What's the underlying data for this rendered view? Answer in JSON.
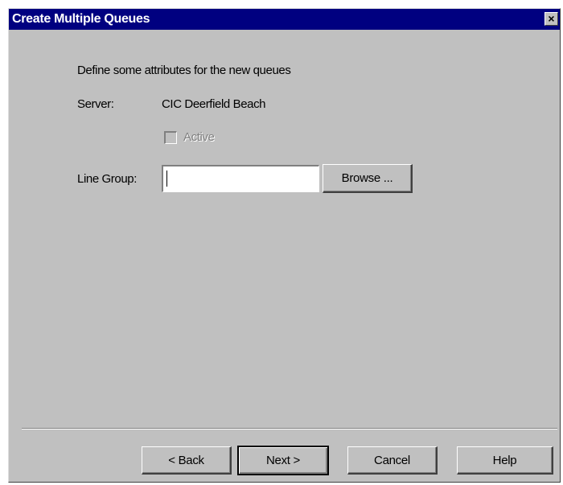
{
  "window": {
    "title": "Create Multiple Queues",
    "close_glyph": "×",
    "close_icon": "close-icon"
  },
  "form": {
    "intro": "Define some attributes for the new queues",
    "server_label": "Server:",
    "server_value": "CIC Deerfield Beach",
    "active_label": "Active",
    "active_checked": false,
    "active_enabled": false,
    "line_group_label": "Line Group:",
    "line_group_value": "",
    "browse_label": "Browse ..."
  },
  "buttons": {
    "back": "< Back",
    "next": "Next >",
    "cancel": "Cancel",
    "help": "Help"
  },
  "colors": {
    "titlebar": "#000080",
    "face": "#c0c0c0"
  }
}
